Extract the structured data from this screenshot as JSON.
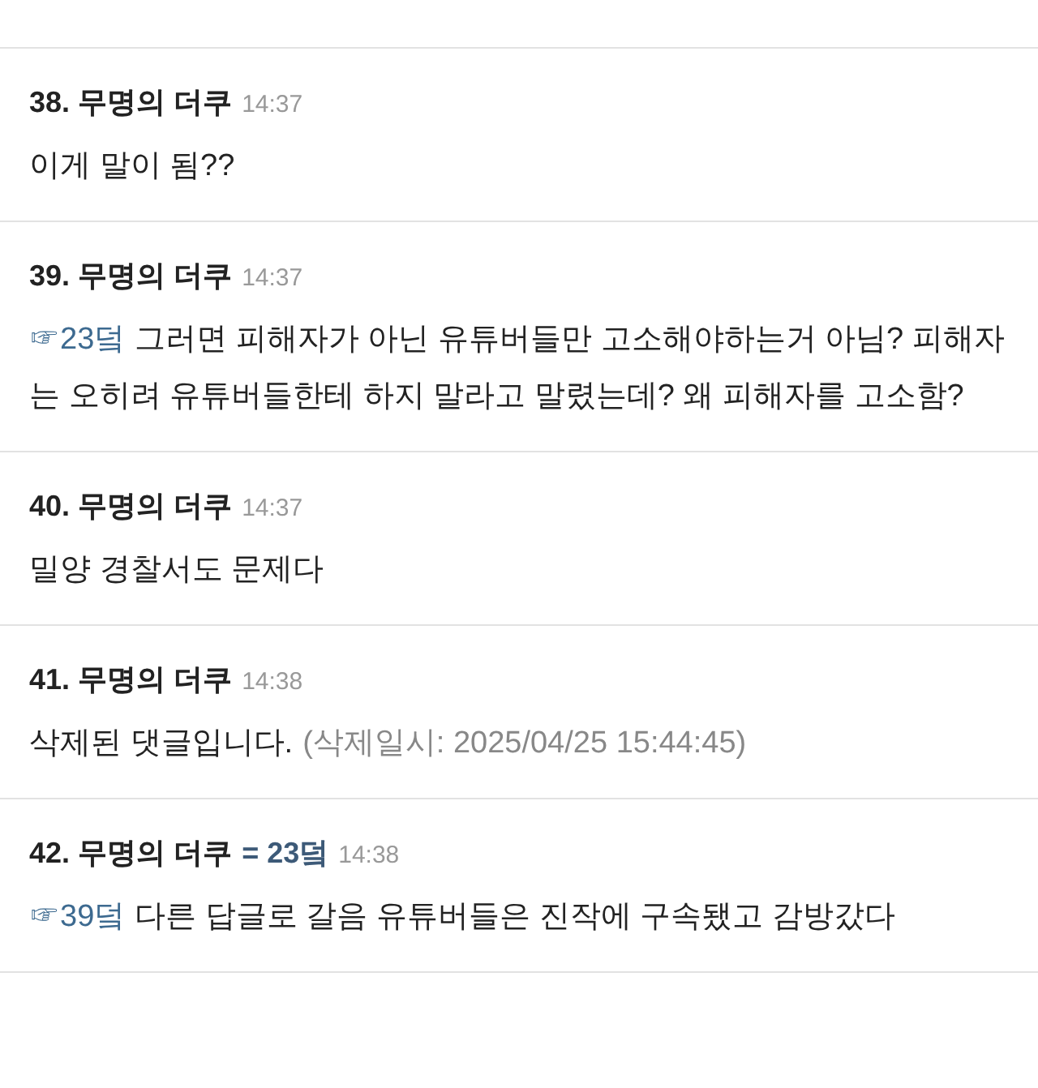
{
  "comments": [
    {
      "number": "38.",
      "author": "무명의 더쿠",
      "time": "14:37",
      "text": "이게 말이 됨??"
    },
    {
      "number": "39.",
      "author": "무명의 더쿠",
      "time": "14:37",
      "ref": "☞23덬",
      "text": "그러면 피해자가 아닌 유튜버들만 고소해야하는거 아님? 피해자는 오히려 유튜버들한테 하지 말라고 말렸는데? 왜 피해자를 고소함?"
    },
    {
      "number": "40.",
      "author": "무명의 더쿠",
      "time": "14:37",
      "text": "밀양 경찰서도 문제다"
    },
    {
      "number": "41.",
      "author": "무명의 더쿠",
      "time": "14:38",
      "text": "삭제된 댓글입니다.",
      "note": "(삭제일시: 2025/04/25 15:44:45)"
    },
    {
      "number": "42.",
      "author": "무명의 더쿠",
      "reply_to": "= 23덬",
      "time": "14:38",
      "ref": "☞39덬",
      "text": "다른 답글로 갈음 유튜버들은 진작에 구속됐고 감방갔다"
    }
  ]
}
